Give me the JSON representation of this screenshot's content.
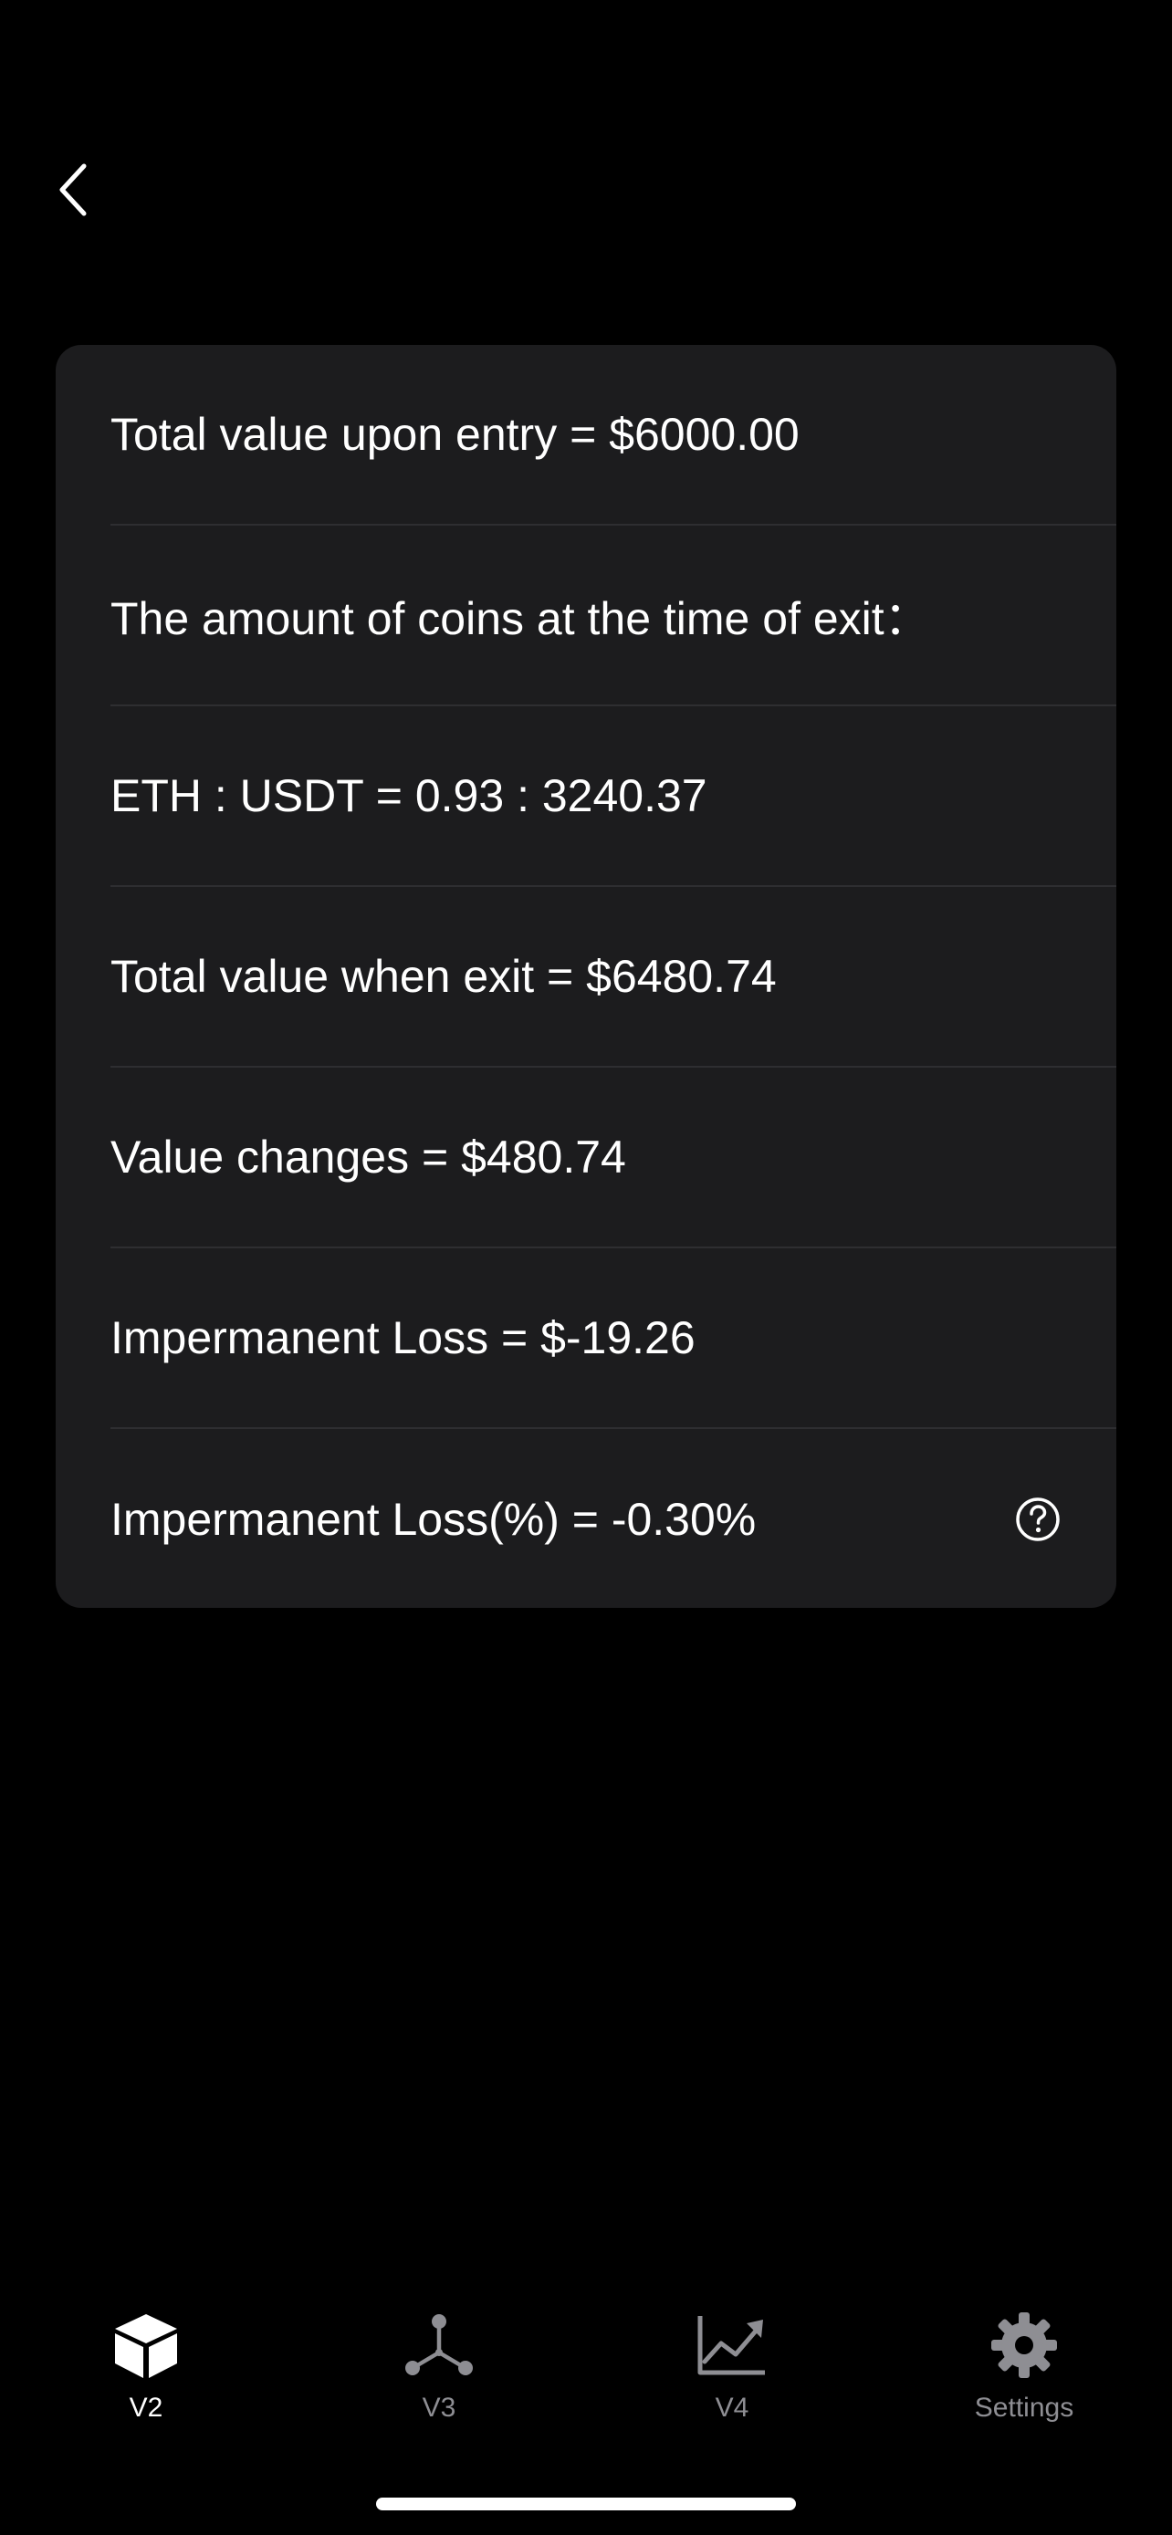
{
  "nav": {
    "back_icon": "chevron-left-icon"
  },
  "results": {
    "total_entry": "Total value upon entry = $6000.00",
    "coins_heading": "The amount of coins at the time of exit：",
    "ratio": "ETH : USDT = 0.93 : 3240.37",
    "total_exit": "Total value when exit = $6480.74",
    "value_changes": "Value changes = $480.74",
    "impermanent_loss": "Impermanent Loss = $-19.26",
    "impermanent_loss_pct": "Impermanent Loss(%) = -0.30%",
    "help_icon": "question-circle-icon"
  },
  "tabs": [
    {
      "label": "V2",
      "icon": "cube-icon",
      "active": true
    },
    {
      "label": "V3",
      "icon": "network-nodes-icon",
      "active": false
    },
    {
      "label": "V4",
      "icon": "trending-chart-icon",
      "active": false
    },
    {
      "label": "Settings",
      "icon": "gear-icon",
      "active": false
    }
  ],
  "colors": {
    "background": "#000000",
    "card": "#1c1c1e",
    "divider": "#2e2e31",
    "active_tab": "#ffffff",
    "inactive_tab": "#8e8e93"
  }
}
